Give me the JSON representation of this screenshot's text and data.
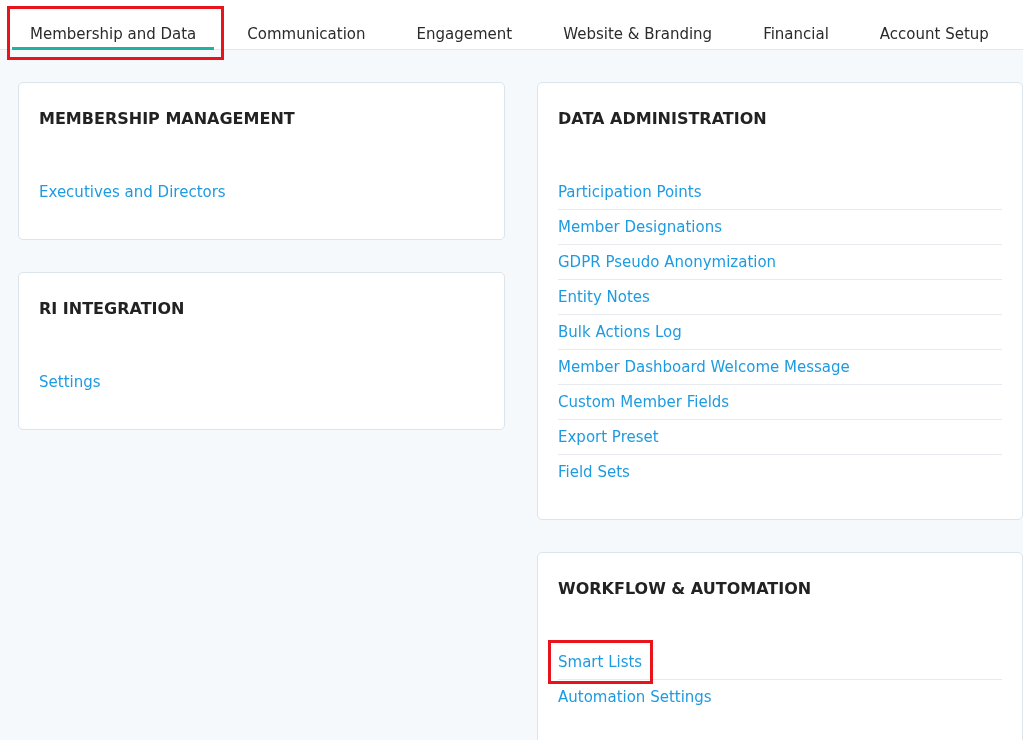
{
  "tabs": [
    {
      "label": "Membership and Data",
      "selected": true,
      "highlighted": true
    },
    {
      "label": "Communication",
      "selected": false,
      "highlighted": false
    },
    {
      "label": "Engagement",
      "selected": false,
      "highlighted": false
    },
    {
      "label": "Website & Branding",
      "selected": false,
      "highlighted": false
    },
    {
      "label": "Financial",
      "selected": false,
      "highlighted": false
    },
    {
      "label": "Account Setup",
      "selected": false,
      "highlighted": false
    }
  ],
  "columns": [
    {
      "sections": [
        {
          "title": "MEMBERSHIP MANAGEMENT",
          "links": [
            {
              "label": "Executives and Directors",
              "highlighted": false
            }
          ]
        },
        {
          "title": "RI INTEGRATION",
          "links": [
            {
              "label": "Settings",
              "highlighted": false
            }
          ]
        }
      ]
    },
    {
      "sections": [
        {
          "title": "DATA ADMINISTRATION",
          "links": [
            {
              "label": "Participation Points",
              "highlighted": false
            },
            {
              "label": "Member Designations",
              "highlighted": false
            },
            {
              "label": "GDPR Pseudo Anonymization",
              "highlighted": false
            },
            {
              "label": "Entity Notes",
              "highlighted": false
            },
            {
              "label": "Bulk Actions Log",
              "highlighted": false
            },
            {
              "label": "Member Dashboard Welcome Message",
              "highlighted": false
            },
            {
              "label": "Custom Member Fields",
              "highlighted": false
            },
            {
              "label": "Export Preset",
              "highlighted": false
            },
            {
              "label": "Field Sets",
              "highlighted": false
            }
          ]
        },
        {
          "title": "WORKFLOW & AUTOMATION",
          "links": [
            {
              "label": "Smart Lists",
              "highlighted": true
            },
            {
              "label": "Automation Settings",
              "highlighted": false
            }
          ]
        }
      ]
    }
  ]
}
